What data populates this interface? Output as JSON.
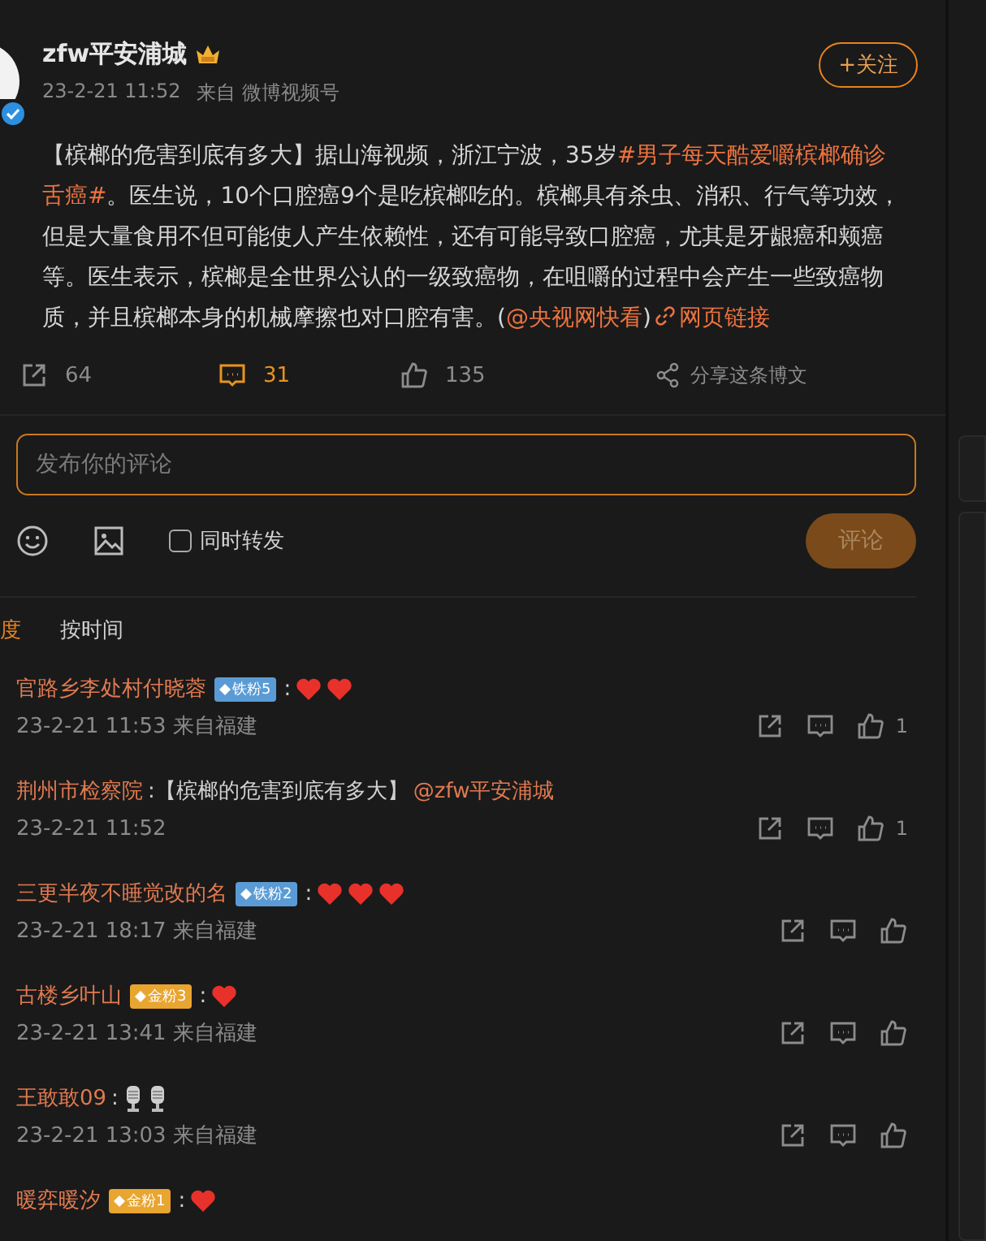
{
  "post": {
    "author": "zfw平安浦城",
    "time": "23-2-21 11:52",
    "source": "来自 微博视频号",
    "follow": "+关注",
    "content": [
      {
        "kind": "text",
        "text": "【槟榔的危害到底有多大】据山海视频，浙江宁波，35岁"
      },
      {
        "kind": "topic",
        "text": "#男子每天酷爱嚼槟榔确诊舌癌#"
      },
      {
        "kind": "text",
        "text": "。医生说，10个口腔癌9个是吃槟榔吃的。槟榔具有杀虫、消积、行气等功效，但是大量食用不但可能使人产生依赖性，还有可能导致口腔癌，尤其是牙龈癌和颊癌等。医生表示，槟榔是全世界公认的一级致癌物，在咀嚼的过程中会产生一些致癌物质，并且槟榔本身的机械摩擦也对口腔有害。("
      },
      {
        "kind": "mention",
        "text": "@央视网快看"
      },
      {
        "kind": "text",
        "text": ")"
      },
      {
        "kind": "link",
        "text": "网页链接"
      }
    ],
    "actions": [
      {
        "kind": "forward",
        "count": "64",
        "active": false
      },
      {
        "kind": "comment",
        "count": "31",
        "active": true
      },
      {
        "kind": "like",
        "count": "135",
        "active": false
      },
      {
        "kind": "share",
        "count": "分享这条博文",
        "active": false
      }
    ]
  },
  "composer": {
    "placeholder": "发布你的评论",
    "repost_label": "同时转发",
    "repost_checked": false,
    "submit": "评论",
    "submit_disabled": true
  },
  "sort_tabs": [
    {
      "label": "度",
      "selected": true
    },
    {
      "label": "按时间",
      "selected": false
    }
  ],
  "comments": [
    {
      "name": "官路乡李处村付晓蓉",
      "badge": {
        "text": "铁粉5",
        "color": "#5b9bd5"
      },
      "body": [
        {
          "kind": "text",
          "text": ":"
        },
        {
          "kind": "heart"
        },
        {
          "kind": "heart"
        }
      ],
      "meta": "23-2-21 11:53 来自福建",
      "likes": "1"
    },
    {
      "name": "荆州市检察院",
      "body": [
        {
          "kind": "text",
          "text": ":【槟榔的危害到底有多大】"
        },
        {
          "kind": "mention",
          "text": "@zfw平安浦城"
        }
      ],
      "meta": "23-2-21 11:52",
      "likes": "1"
    },
    {
      "name": "三更半夜不睡觉改的名",
      "badge": {
        "text": "铁粉2",
        "color": "#5b9bd5"
      },
      "body": [
        {
          "kind": "text",
          "text": ":"
        },
        {
          "kind": "heart"
        },
        {
          "kind": "heart"
        },
        {
          "kind": "heart"
        }
      ],
      "meta": "23-2-21 18:17 来自福建"
    },
    {
      "name": "古楼乡叶山",
      "badge": {
        "text": "金粉3",
        "color": "#e8a530"
      },
      "body": [
        {
          "kind": "text",
          "text": ":"
        },
        {
          "kind": "heart"
        }
      ],
      "meta": "23-2-21 13:41 来自福建"
    },
    {
      "name": "王敢敢09",
      "body": [
        {
          "kind": "text",
          "text": ":"
        },
        {
          "kind": "mic"
        },
        {
          "kind": "mic"
        }
      ],
      "meta": "23-2-21 13:03 来自福建"
    },
    {
      "name": "暖弈暖汐",
      "badge": {
        "text": "金粉1",
        "color": "#e8a530"
      },
      "body": [
        {
          "kind": "text",
          "text": ":"
        },
        {
          "kind": "heart"
        }
      ]
    }
  ]
}
